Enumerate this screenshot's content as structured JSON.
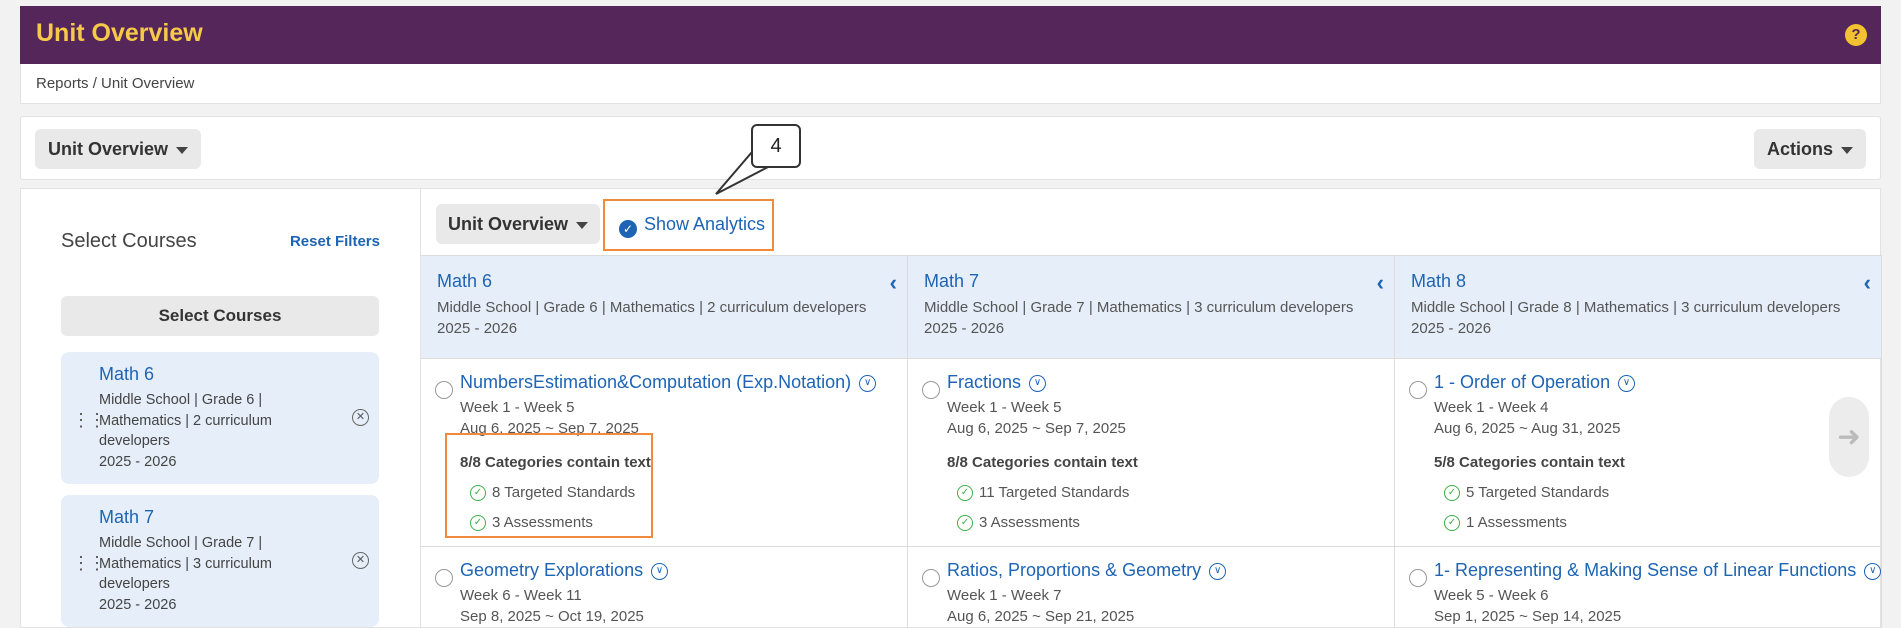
{
  "header": {
    "title": "Unit Overview",
    "help_icon": "?"
  },
  "breadcrumb": {
    "text": "Reports / Unit Overview"
  },
  "toolbar": {
    "view_label": "Unit Overview",
    "actions_label": "Actions"
  },
  "sidebar": {
    "heading": "Select Courses",
    "reset_label": "Reset Filters",
    "select_button": "Select Courses",
    "courses": [
      {
        "name": "Math 6",
        "meta1": "Middle School | Grade 6 |",
        "meta2": " Mathematics | 2 curriculum",
        "meta3": "developers",
        "year": "2025 - 2026"
      },
      {
        "name": "Math 7",
        "meta1": "Middle School | Grade 7 |",
        "meta2": " Mathematics | 3 curriculum",
        "meta3": "developers",
        "year": "2025 - 2026"
      }
    ]
  },
  "content": {
    "view_label": "Unit Overview",
    "show_analytics_label": "Show Analytics",
    "callout_number": "4",
    "columns": [
      {
        "name": "Math 6",
        "meta": "Middle School | Grade 6 | Mathematics | 2 curriculum developers",
        "year": "2025 - 2026"
      },
      {
        "name": "Math 7",
        "meta": "Middle School | Grade 7 | Mathematics | 3 curriculum developers",
        "year": "2025 - 2026"
      },
      {
        "name": "Math 8",
        "meta": "Middle School | Grade 8 | Mathematics | 3 curriculum developers",
        "year": "2025 - 2026"
      }
    ],
    "row1": [
      {
        "name": "NumbersEstimation&Computation (Exp.Notation)",
        "weeks": "Week 1 - Week 5",
        "dates": "Aug 6, 2025 ~ Sep 7, 2025",
        "categories": "8/8 Categories contain text",
        "standards": "8 Targeted Standards",
        "assessments": "3 Assessments"
      },
      {
        "name": "Fractions",
        "weeks": "Week 1 - Week 5",
        "dates": "Aug 6, 2025 ~ Sep 7, 2025",
        "categories": "8/8 Categories contain text",
        "standards": "11 Targeted Standards",
        "assessments": "3 Assessments"
      },
      {
        "name": "1 - Order of Operation",
        "weeks": "Week 1 - Week 4",
        "dates": "Aug 6, 2025 ~ Aug 31, 2025",
        "categories": "5/8 Categories contain text",
        "standards": "5 Targeted Standards",
        "assessments": "1 Assessments"
      }
    ],
    "row2": [
      {
        "name": "Geometry Explorations",
        "weeks": "Week 6 - Week 11",
        "dates": "Sep 8, 2025 ~ Oct 19, 2025"
      },
      {
        "name": "Ratios, Proportions & Geometry",
        "weeks": "Week 1 - Week 7",
        "dates": "Aug 6, 2025 ~ Sep 21, 2025"
      },
      {
        "name": "1- Representing & Making Sense of Linear Functions",
        "weeks": "Week 5 - Week 6",
        "dates": "Sep 1, 2025 ~ Sep 14, 2025"
      }
    ]
  },
  "colors": {
    "header_bg": "#54265a",
    "header_title": "#f7c948",
    "link": "#1e64b4",
    "highlight": "#f08a3c",
    "check": "#3fae49"
  },
  "icons": {
    "help": "question-circle-icon",
    "caret": "caret-down-icon",
    "grip": "drag-handle-icon",
    "remove": "close-circle-icon",
    "collapse": "chevron-left-icon",
    "expand": "chevron-down-circle-icon",
    "check": "check-circle-icon",
    "next": "arrow-right-icon"
  }
}
